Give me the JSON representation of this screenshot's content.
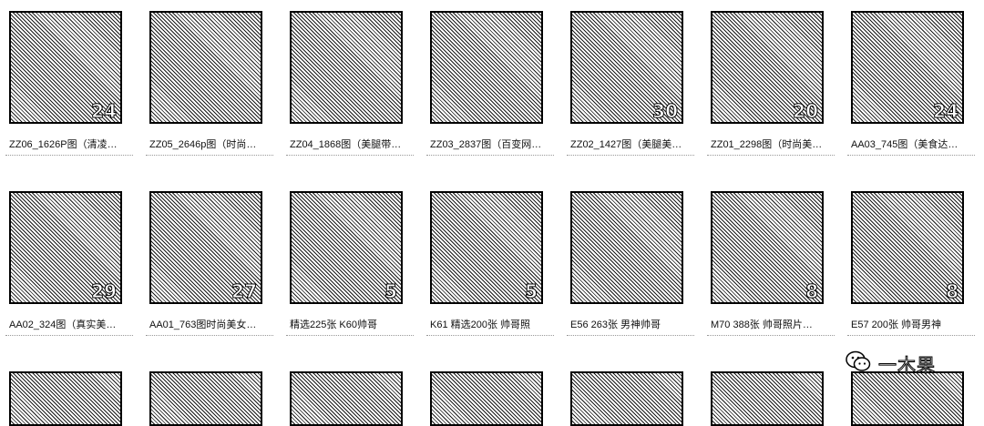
{
  "items": [
    {
      "caption": "ZZ06_1626P图（清凌…",
      "badge": "24"
    },
    {
      "caption": "ZZ05_2646p图（时尚…",
      "badge": ""
    },
    {
      "caption": "ZZ04_1868图（美腿带…",
      "badge": ""
    },
    {
      "caption": "ZZ03_2837图（百变网…",
      "badge": ""
    },
    {
      "caption": "ZZ02_1427图（美腿美…",
      "badge": "30"
    },
    {
      "caption": "ZZ01_2298图（时尚美…",
      "badge": "20"
    },
    {
      "caption": "AA03_745图（美食达…",
      "badge": "24"
    },
    {
      "caption": "AA02_324图（真实美…",
      "badge": "29"
    },
    {
      "caption": "AA01_763图时尚美女…",
      "badge": "27"
    },
    {
      "caption": "精选225张 K60帅哥",
      "badge": "5"
    },
    {
      "caption": "K61 精选200张 帅哥照",
      "badge": "5"
    },
    {
      "caption": "E56 263张 男神帅哥",
      "badge": ""
    },
    {
      "caption": "M70 388张 帅哥照片…",
      "badge": "8"
    },
    {
      "caption": "E57 200张 帅哥男神",
      "badge": "8"
    }
  ],
  "watermark": {
    "text": "一木果",
    "icon": "wechat-icon"
  }
}
